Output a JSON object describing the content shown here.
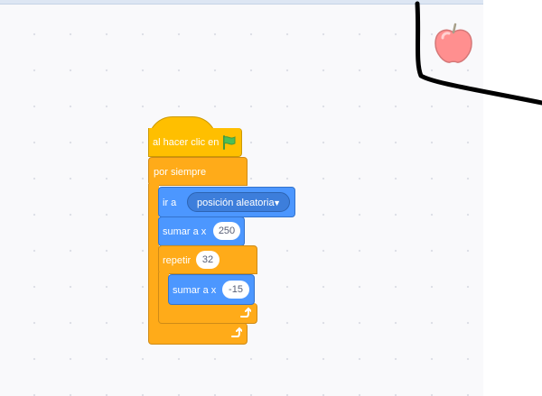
{
  "script": {
    "hat": {
      "label": "al hacer clic en",
      "icon": "green-flag-icon"
    },
    "forever": {
      "label": "por siempre",
      "icon": "loop-arrow-icon"
    },
    "goto": {
      "label": "ir a",
      "dropdown_value": "posición aleatoria"
    },
    "change_x_1": {
      "label": "sumar a x",
      "value": "250"
    },
    "repeat": {
      "label": "repetir",
      "value": "32",
      "icon": "loop-arrow-icon"
    },
    "change_x_2": {
      "label": "sumar a x",
      "value": "-15"
    }
  },
  "stage": {
    "sprite": "apple-icon"
  },
  "colors": {
    "events": "#ffbf00",
    "control": "#ffab19",
    "motion": "#4c97ff",
    "workspace": "#f9f9fb",
    "pen": "#000000"
  }
}
